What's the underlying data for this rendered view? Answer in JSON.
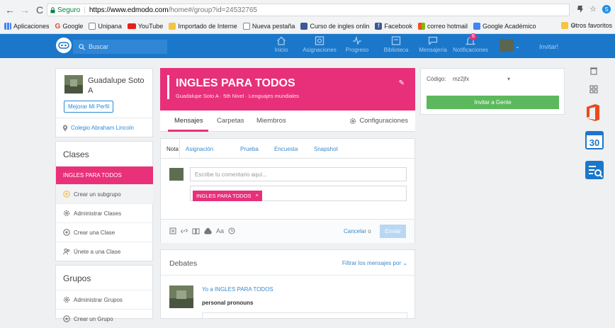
{
  "browser": {
    "secure_label": "Seguro",
    "url_host": "https://www.edmodo.com",
    "url_path": "/home#/group?id=24532765",
    "bookmarks": [
      {
        "label": "Aplicaciones",
        "color": "#4285f4"
      },
      {
        "label": "Google",
        "color": "#ea4335"
      },
      {
        "label": "Unipana",
        "color": "#ffffff"
      },
      {
        "label": "YouTube",
        "color": "#e62117"
      },
      {
        "label": "Importado de Interne",
        "color": "#f5c542"
      },
      {
        "label": "Nueva pestaña",
        "color": "#ffffff"
      },
      {
        "label": "Curso de ingles onlin",
        "color": "#3b5998"
      },
      {
        "label": "Facebook",
        "color": "#3b5998"
      },
      {
        "label": "correo hotmail",
        "color": "#f25022"
      },
      {
        "label": "Google Académico",
        "color": "#4285f4"
      }
    ],
    "bookmarks_more": "»",
    "other_bookmarks": "Otros favoritos"
  },
  "topbar": {
    "search_placeholder": "Buscar",
    "nav": [
      {
        "label": "Inicio"
      },
      {
        "label": "Asignaciones"
      },
      {
        "label": "Progreso"
      },
      {
        "label": "Biblioteca"
      },
      {
        "label": "Mensajería"
      },
      {
        "label": "Notificaciones",
        "badge": "6"
      }
    ],
    "invite_label": "Invitar!"
  },
  "profile": {
    "name": "Guadalupe Soto A",
    "improve_button": "Mejorar Mi Perfil",
    "school": "Colegio Abraham Lincoln"
  },
  "classes": {
    "title": "Clases",
    "active_class": "INGLES PARA TODOS",
    "items": [
      {
        "label": "Crear un subgrupo"
      },
      {
        "label": "Administrar Clases"
      },
      {
        "label": "Crear una Clase"
      },
      {
        "label": "Únete a una Clase"
      }
    ]
  },
  "groups": {
    "title": "Grupos",
    "items": [
      {
        "label": "Administrar Grupos"
      },
      {
        "label": "Crear un Grupo"
      }
    ]
  },
  "group": {
    "title": "INGLES PARA TODOS",
    "subtitle": "Guadalupe Soto A · 5th Nivel · Lenguajes mundiales",
    "tabs": [
      {
        "label": "Mensajes"
      },
      {
        "label": "Carpetas"
      },
      {
        "label": "Miembros"
      }
    ],
    "settings_label": "Configuraciones"
  },
  "composer": {
    "tabs": [
      {
        "label": "Nota"
      },
      {
        "label": "Asignación"
      },
      {
        "label": "Prueba"
      },
      {
        "label": "Encuesta"
      },
      {
        "label": "Snapshot"
      }
    ],
    "comment_placeholder": "Escribe tu comentario aquí...",
    "recipient": "INGLES PARA TODOS",
    "remove_symbol": "×",
    "font_label": "Aa",
    "cancel_label": "Cancelar",
    "or_label": "o",
    "send_label": "Enviar"
  },
  "feed": {
    "title": "Debates",
    "filter_label": "Filtrar los mensajes por",
    "post": {
      "author": "Yo a INGLES PARA TODOS",
      "text": "personal pronouns"
    }
  },
  "code": {
    "label": "Código:",
    "value": "mz2jfx",
    "invite_button": "Invitar a Gente"
  },
  "colors": {
    "brand_blue": "#1b77c9",
    "group_pink": "#e8307a",
    "invite_green": "#5cb85c"
  }
}
